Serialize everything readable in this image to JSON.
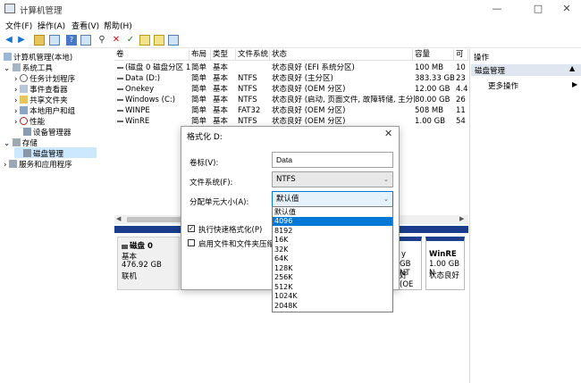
{
  "window": {
    "title": "计算机管理",
    "minimize": "—",
    "maximize": "□",
    "close": "✕"
  },
  "menu": [
    "文件(F)",
    "操作(A)",
    "查看(V)",
    "帮助(H)"
  ],
  "tree": {
    "root": "计算机管理(本地)",
    "items": [
      {
        "label": "系统工具"
      },
      {
        "label": "任务计划程序"
      },
      {
        "label": "事件查看器"
      },
      {
        "label": "共享文件夹"
      },
      {
        "label": "本地用户和组"
      },
      {
        "label": "性能"
      },
      {
        "label": "设备管理器"
      },
      {
        "label": "存储"
      },
      {
        "label": "磁盘管理"
      },
      {
        "label": "服务和应用程序"
      }
    ]
  },
  "table": {
    "headers": [
      "卷",
      "布局",
      "类型",
      "文件系统",
      "状态",
      "容量",
      "可"
    ],
    "rows": [
      [
        "(磁盘 0 磁盘分区 1)",
        "简单",
        "基本",
        "",
        "状态良好 (EFI 系统分区)",
        "100 MB",
        "10"
      ],
      [
        "Data (D:)",
        "简单",
        "基本",
        "NTFS",
        "状态良好 (主分区)",
        "383.33 GB",
        "23"
      ],
      [
        "Onekey",
        "简单",
        "基本",
        "NTFS",
        "状态良好 (OEM 分区)",
        "12.00 GB",
        "4.4"
      ],
      [
        "Windows (C:)",
        "简单",
        "基本",
        "NTFS",
        "状态良好 (启动, 页面文件, 故障转储, 主分区)",
        "80.00 GB",
        "26"
      ],
      [
        "WINPE",
        "简单",
        "基本",
        "FAT32",
        "状态良好 (OEM 分区)",
        "508 MB",
        "11"
      ],
      [
        "WinRE",
        "简单",
        "基本",
        "NTFS",
        "状态良好 (OEM 分区)",
        "1.00 GB",
        "54"
      ]
    ]
  },
  "disk": {
    "name": "磁盘 0",
    "type": "基本",
    "size": "476.92 GB",
    "status": "联机",
    "partial_text1": "y",
    "partial_text2": "GB NT",
    "partial_text3": "好 (OE",
    "winre_name": "WinRE",
    "winre_size": "1.00 GB N",
    "winre_status": "状态良好"
  },
  "actions": {
    "header": "操作",
    "section": "磁盘管理",
    "more": "更多操作"
  },
  "dialog": {
    "title": "格式化 D:",
    "label_volume": "卷标(V):",
    "volume_value": "Data",
    "label_fs": "文件系统(F):",
    "fs_value": "NTFS",
    "label_alloc": "分配单元大小(A):",
    "alloc_value": "默认值",
    "quick_format": "执行快速格式化(P)",
    "compress": "启用文件和文件夹压缩(E"
  },
  "dropdown": {
    "options": [
      "默认值",
      "4096",
      "8192",
      "16K",
      "32K",
      "64K",
      "128K",
      "256K",
      "512K",
      "1024K",
      "2048K"
    ],
    "highlighted": "4096"
  },
  "colors": {
    "accent": "#0078d7",
    "selection": "#cce8ff",
    "disk_bar": "#1a3e8c"
  }
}
